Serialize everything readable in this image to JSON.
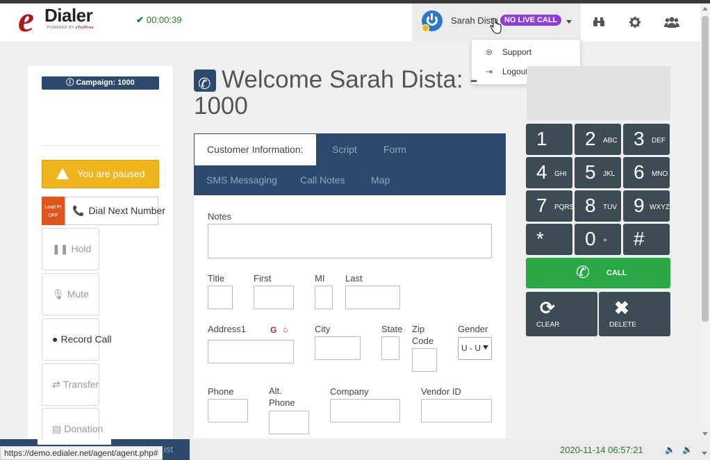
{
  "header": {
    "logo_letter": "e",
    "logo_word": "Dialer",
    "logo_sub_prefix": "POWERED BY",
    "logo_sub_brand": "eTollFree",
    "timer": "00:00:39",
    "user_name": "Sarah Dista",
    "call_status": "NO LIVE CALL",
    "icons": [
      "binoculars-icon",
      "gear-icon",
      "users-icon"
    ]
  },
  "dropdown": {
    "items": [
      {
        "label": "Support",
        "icon": "lifebuoy-icon"
      },
      {
        "label": "Logout",
        "icon": "logout-icon"
      }
    ]
  },
  "left": {
    "campaign": "Campaign: 1000",
    "paused": "You are paused",
    "lead_preview_label": "Lead Pr",
    "lead_preview_state": "OFF",
    "dial_next": "Dial Next Number",
    "hold": "Hold",
    "mute": "Mute",
    "record": "Record Call",
    "transfer": "Transfer",
    "donation": "Donation",
    "list_fragment": "ist"
  },
  "main": {
    "welcome": "Welcome Sarah Dista: -",
    "welcome_line2": "1000",
    "tabs": [
      "Customer Information:",
      "Script",
      "Form",
      "SMS Messaging",
      "Call Notes",
      "Map"
    ],
    "fields": {
      "notes": "Notes",
      "title": "Title",
      "first": "First",
      "mi": "MI",
      "last": "Last",
      "address1": "Address1",
      "city": "City",
      "state": "State",
      "zip_line1": "Zip",
      "zip_line2": "Code",
      "gender": "Gender",
      "gender_value": "U - U",
      "phone": "Phone",
      "alt_line1": "Alt.",
      "alt_line2": "Phone",
      "company": "Company",
      "vendor": "Vendor ID"
    }
  },
  "dialpad": {
    "keys": [
      {
        "d": "1",
        "s": ""
      },
      {
        "d": "2",
        "s": "ABC"
      },
      {
        "d": "3",
        "s": "DEF"
      },
      {
        "d": "4",
        "s": "GHI"
      },
      {
        "d": "5",
        "s": "JKL"
      },
      {
        "d": "6",
        "s": "MNO"
      },
      {
        "d": "7",
        "s": "PQRS"
      },
      {
        "d": "8",
        "s": "TUV"
      },
      {
        "d": "9",
        "s": "WXYZ"
      },
      {
        "d": "*",
        "s": ""
      },
      {
        "d": "0",
        "s": "+"
      },
      {
        "d": "#",
        "s": ""
      }
    ],
    "call": "CALL",
    "clear": "CLEAR",
    "delete": "DELETE"
  },
  "footer": {
    "url": "https://demo.edialer.net/agent/agent.php#",
    "datetime": "2020-11-14 06:57:21"
  }
}
